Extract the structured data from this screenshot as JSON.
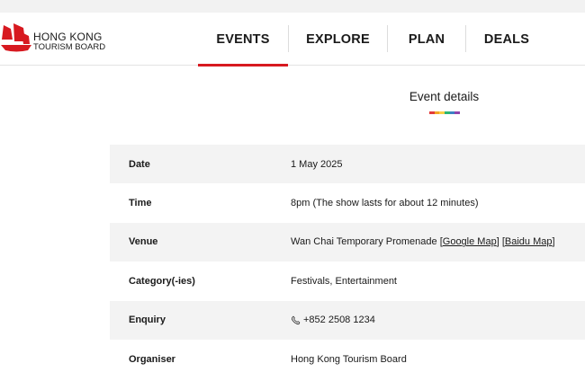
{
  "brand": {
    "line1": "HONG KONG",
    "line2": "TOURISM BOARD",
    "accent_color": "#d71920"
  },
  "nav": {
    "items": [
      {
        "label": "EVENTS",
        "active": true
      },
      {
        "label": "EXPLORE",
        "active": false
      },
      {
        "label": "PLAN",
        "active": false
      },
      {
        "label": "DEALS",
        "active": false
      }
    ]
  },
  "section": {
    "title": "Event details",
    "rainbow_colors": [
      "#e23b3b",
      "#f5a623",
      "#f7d046",
      "#2bb673",
      "#3b82c4",
      "#8e44ad"
    ]
  },
  "details": {
    "date": {
      "label": "Date",
      "value": "1 May 2025"
    },
    "time": {
      "label": "Time",
      "value": "8pm (The show lasts for about 12 minutes)"
    },
    "venue": {
      "label": "Venue",
      "value": "Wan Chai Temporary Promenade",
      "google_link": "Google Map",
      "baidu_link": "Baidu Map"
    },
    "category": {
      "label": "Category(-ies)",
      "value": "Festivals, Entertainment"
    },
    "enquiry": {
      "label": "Enquiry",
      "value": "+852 2508 1234",
      "icon": "phone-icon"
    },
    "organiser": {
      "label": "Organiser",
      "value": "Hong Kong Tourism Board"
    }
  }
}
